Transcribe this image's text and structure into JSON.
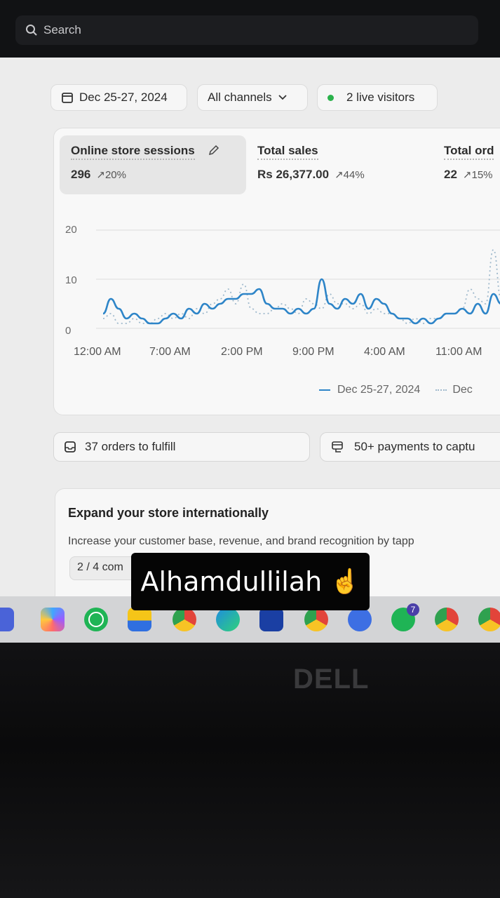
{
  "search": {
    "label": "Search"
  },
  "filters": {
    "date": "Dec 25-27, 2024",
    "channels": "All channels",
    "live_visitors": "2 live visitors"
  },
  "metrics": [
    {
      "label": "Online store sessions",
      "value": "296",
      "change": "↗20%"
    },
    {
      "label": "Total sales",
      "value": "Rs 26,377.00",
      "change": "↗44%"
    },
    {
      "label": "Total ord",
      "value": "22",
      "change": "↗15%"
    }
  ],
  "chart_data": {
    "type": "line",
    "y_ticks": [
      "20",
      "10",
      "0"
    ],
    "ylim": [
      0,
      20
    ],
    "x_ticks": [
      "12:00 AM",
      "7:00 AM",
      "2:00 PM",
      "9:00 PM",
      "4:00 AM",
      "11:00 AM"
    ],
    "series": [
      {
        "name": "Dec 25-27, 2024",
        "style": "solid",
        "color": "#2e85c8",
        "values": [
          3,
          6,
          4,
          2,
          3,
          2,
          1,
          1,
          2,
          3,
          2,
          4,
          3,
          5,
          4,
          5,
          6,
          6,
          7,
          7,
          8,
          5,
          4,
          4,
          3,
          4,
          3,
          4,
          10,
          5,
          4,
          6,
          5,
          7,
          4,
          6,
          5,
          3,
          2,
          2,
          1,
          2,
          1,
          2,
          3,
          3,
          4,
          3,
          5,
          3,
          7,
          5,
          6,
          4
        ]
      },
      {
        "name": "Dec",
        "style": "dotted",
        "color": "#9fb9cc",
        "values": [
          2,
          3,
          1,
          1,
          2,
          1,
          1,
          2,
          3,
          2,
          3,
          2,
          4,
          3,
          5,
          6,
          8,
          5,
          9,
          4,
          3,
          3,
          4,
          5,
          4,
          3,
          6,
          5,
          4,
          7,
          5,
          5,
          4,
          5,
          3,
          4,
          3,
          3,
          2,
          1,
          2,
          1,
          2,
          2,
          3,
          3,
          4,
          8,
          6,
          5,
          16,
          6,
          5,
          4
        ]
      }
    ],
    "legend": "bottom-right"
  },
  "tasks": {
    "orders": "37 orders to fulfill",
    "payments": "50+ payments to captu"
  },
  "expand": {
    "title": "Expand your store internationally",
    "description": "Increase your customer base, revenue, and brand recognition by tapp",
    "progress": "2 / 4 com"
  },
  "sticker": {
    "text": "Alhamdullilah",
    "emoji": "☝️"
  },
  "brand": "DELL",
  "taskbar_icons": [
    "video-icon",
    "copilot-icon",
    "whatsapp-icon",
    "file-explorer-icon",
    "chrome-icon",
    "edge-icon",
    "store-icon",
    "chrome-icon",
    "brave-icon",
    "whatsapp-icon",
    "chrome-icon",
    "chrome-icon"
  ],
  "taskbar_badge": "7"
}
